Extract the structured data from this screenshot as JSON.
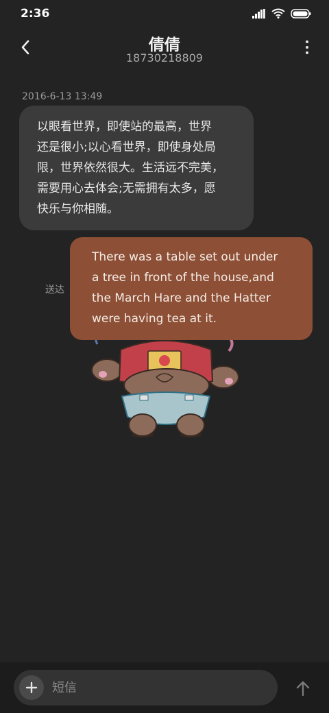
{
  "status_bar": {
    "time": "2:36",
    "icons": [
      "signal-icon",
      "wifi-icon",
      "battery-icon"
    ]
  },
  "header": {
    "contact_name": "倩倩",
    "contact_number": "18730218809",
    "icons": [
      "back-arrow-icon",
      "more-vertical-icon"
    ]
  },
  "conversation": {
    "timestamp": "2016-6-13 13:49",
    "incoming_message": {
      "lines": [
        "以眼看世界，即使站的最高，世界",
        "还是很小;以心看世界，即使身处局",
        "限，世界依然很大。生活远不完美，",
        "需要用心去体会;无需拥有太多，愿",
        "快乐与你相随。"
      ]
    },
    "outgoing_message": {
      "lines": [
        "There was a table set out under",
        "a tree in front of the house,and",
        "the March Hare and the Hatter",
        "were having tea at it."
      ]
    },
    "delivery_status": "送达"
  },
  "compose": {
    "placeholder": "短信",
    "icons": [
      "plus-icon",
      "send-arrow-icon"
    ]
  },
  "colors": {
    "background": "#232323",
    "incoming_bubble": "#3b3b3b",
    "outgoing_bubble": "#8d4f35",
    "bottom_bar": "#1c1c1c"
  }
}
